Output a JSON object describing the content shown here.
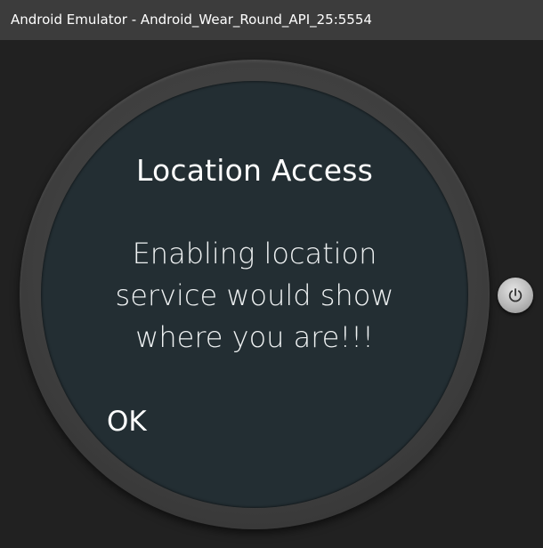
{
  "window": {
    "title": "Android Emulator - Android_Wear_Round_API_25:5554"
  },
  "dialog": {
    "title": "Location Access",
    "message": "Enabling location service would show where you are!!!",
    "ok_label": "OK"
  },
  "device": {
    "power_icon": "power-icon"
  },
  "colors": {
    "titlebar": "#3c3c3c",
    "background": "#212121",
    "bezel": "#404040",
    "screen": "#232e33",
    "text": "#ffffff"
  }
}
